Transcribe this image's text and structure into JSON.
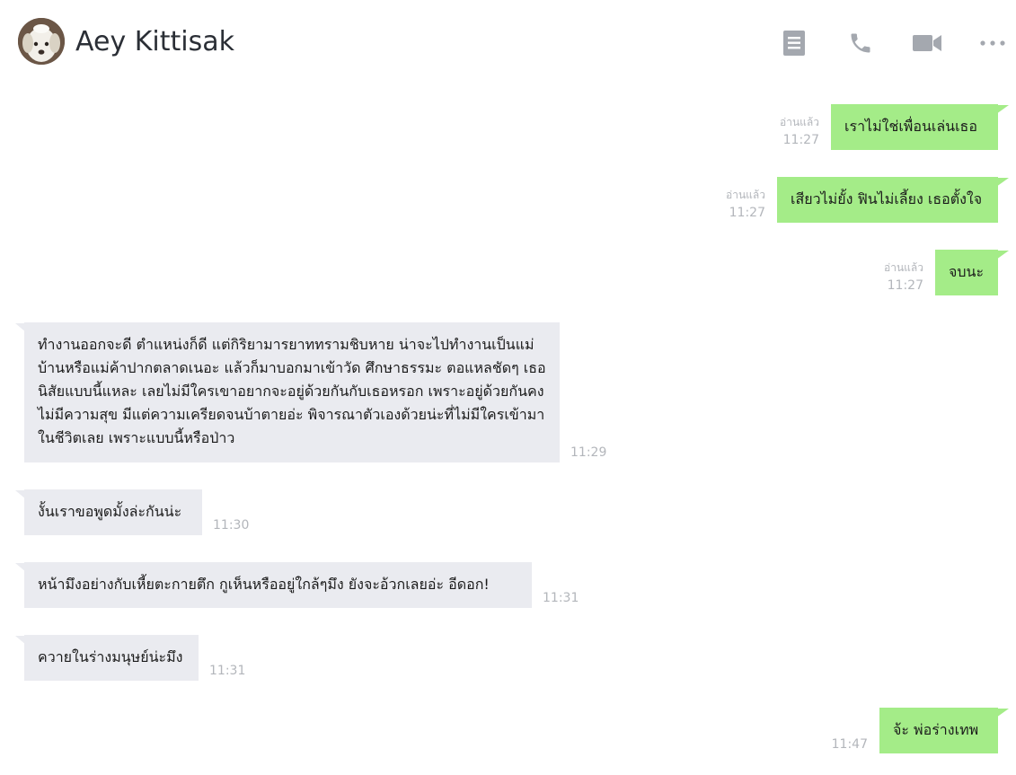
{
  "header": {
    "contact_name": "Aey Kittisak",
    "actions": [
      {
        "icon": "note-icon"
      },
      {
        "icon": "phone-icon"
      },
      {
        "icon": "video-call-icon"
      },
      {
        "icon": "more-options-icon"
      }
    ]
  },
  "colors": {
    "outgoing_bubble": "#a4ec88",
    "incoming_bubble": "#eaebf0",
    "meta_text": "#b3b6bb",
    "icon": "#9ea3ab"
  },
  "messages": [
    {
      "direction": "out",
      "text": "เราไม่ใช่เพื่อนเล่นเธอ",
      "read": "อ่านแล้ว",
      "time": "11:27"
    },
    {
      "direction": "out",
      "text": "เสียวไม่ยั้ง ฟินไม่เลี้ยง เธอตั้งใจ",
      "read": "อ่านแล้ว",
      "time": "11:27"
    },
    {
      "direction": "out",
      "text": "จบนะ",
      "read": "อ่านแล้ว",
      "time": "11:27"
    },
    {
      "direction": "in",
      "text": "ทำงานออกจะดี ตำแหน่งก็ดี แต่กิริยามารยาททรามชิบหาย น่าจะไปทำงานเป็นแม่บ้านหรือแม่ค้าปากตลาดเนอะ แล้วก็มาบอกมาเข้าวัด ศึกษาธรรมะ ตอแหลชัดๆ เธอนิสัยแบบนี้แหละ เลยไม่มีใครเขาอยากจะอยู่ด้วยกันกับเธอหรอก เพราะอยู่ด้วยกันคงไม่มีความสุข มีแต่ความเครียดจนบ้าตายอ่ะ พิจารณาตัวเองด้วยน่ะที่ไม่มีใครเข้ามาในชีวิตเลย เพราะแบบนี้หรือป่าว",
      "time": "11:29"
    },
    {
      "direction": "in",
      "text": "งั้นเราขอพูดมั้งล่ะกันน่ะ",
      "time": "11:30"
    },
    {
      "direction": "in",
      "text": "หน้ามึงอย่างกับเหี้ยตะกายตึก กูเห็นหรืออยู่ใกล้ๆมึง ยังจะอ้วกเลยอ่ะ อีดอก!",
      "time": "11:31"
    },
    {
      "direction": "in",
      "text": "ควายในร่างมนุษย์น่ะมึง",
      "time": "11:31"
    },
    {
      "direction": "out",
      "text": "จ้ะ พ่อร่างเทพ",
      "time": "11:47"
    }
  ]
}
